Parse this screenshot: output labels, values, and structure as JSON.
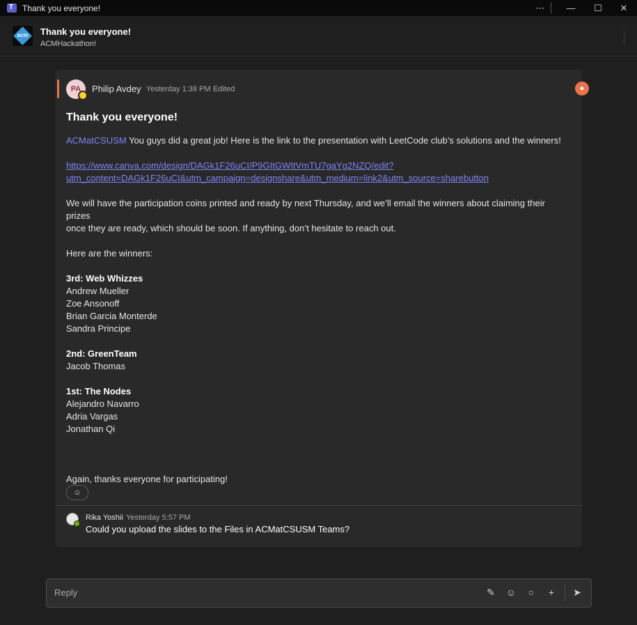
{
  "window": {
    "title": "Thank you everyone!",
    "controls": {
      "more": "⋯",
      "minimize": "—",
      "maximize": "☐",
      "close": "✕"
    }
  },
  "header": {
    "title": "Thank you everyone!",
    "channel": "ACMHackathon!",
    "logo_text": "acm"
  },
  "post": {
    "author_initials": "PA",
    "author": "Philip Avdey",
    "timestamp": "Yesterday 1:38 PM",
    "edited": "Edited",
    "subject": "Thank you everyone!",
    "mention": "ACMatCSUSM",
    "intro": " You guys did a great job! Here is the link to the presentation with LeetCode club’s solutions and the winners!",
    "link_line1": "https://www.canva.com/design/DAGk1F26uCI/P9GItGWItVmTU7gaYg2NZQ/edit?",
    "link_line2": "utm_content=DAGk1F26uCI&utm_campaign=designshare&utm_medium=link2&utm_source=sharebutton",
    "coins_line1": "We will have the participation coins printed and ready by next Thursday, and we’ll email the winners about claiming their prizes",
    "coins_line2": "once they are ready, which should be soon. If anything, don’t hesitate to reach out.",
    "winners_intro": "Here are the winners:",
    "places": [
      {
        "heading": "3rd: Web Whizzes",
        "members": [
          "Andrew Mueller",
          "Zoe Ansonoff",
          "Brian Garcia Monterde",
          "Sandra Principe"
        ]
      },
      {
        "heading": "2nd: GreenTeam",
        "members": [
          "Jacob Thomas"
        ]
      },
      {
        "heading": "1st: The Nodes",
        "members": [
          "Alejandro Navarro",
          "Adria Vargas",
          "Jonathan Qi"
        ]
      }
    ],
    "closing": "Again, thanks everyone for participating!"
  },
  "reply": {
    "author": "Rika Yoshii",
    "timestamp": "Yesterday 5:57 PM",
    "text": "Could you upload the slides to the Files in ACMatCSUSM Teams?"
  },
  "compose": {
    "placeholder": "Reply",
    "icons": [
      "format-icon",
      "emoji-icon",
      "loop-icon",
      "plus-icon",
      "send-icon"
    ]
  },
  "colors": {
    "accent": "#e97548",
    "mention": "#7f85f5",
    "background": "#1f1f1f",
    "card": "#292929"
  }
}
